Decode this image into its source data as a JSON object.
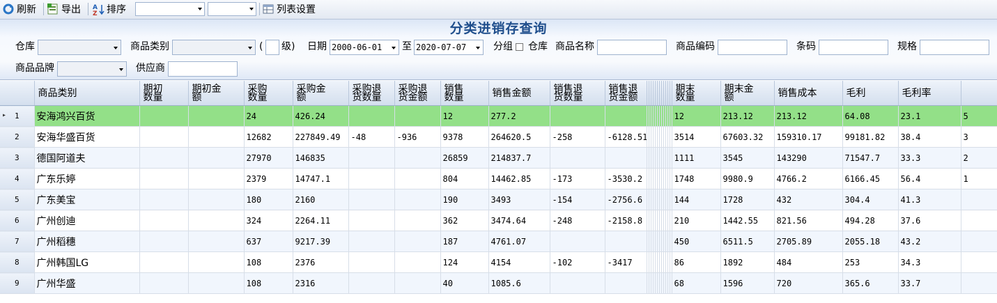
{
  "toolbar": {
    "refresh": "刷新",
    "export": "导出",
    "sort": "排序",
    "column_settings": "列表设置"
  },
  "form": {
    "title": "分类进销存查询",
    "warehouse_label": "仓库",
    "category_label": "商品类别",
    "level_open": "(",
    "level_close": "级)",
    "date_label": "日期",
    "date_from": "2000-06-01",
    "to_label": "至",
    "date_to": "2020-07-07",
    "group_label": "分组",
    "group_warehouse_label": "仓库",
    "product_name_label": "商品名称",
    "product_code_label": "商品编码",
    "barcode_label": "条码",
    "spec_label": "规格",
    "brand_label": "商品品牌",
    "supplier_label": "供应商"
  },
  "grid": {
    "columns": [
      "商品类别",
      "期初数量",
      "期初金额",
      "采购数量",
      "采购金额",
      "采购退货数量",
      "采购退货金额",
      "销售数量",
      "销售金额",
      "销售退货数量",
      "销售退货金额",
      "期末数量",
      "期末金额",
      "销售成本",
      "毛利",
      "毛利率"
    ],
    "header_lines": [
      [
        "商品类别"
      ],
      [
        "期初",
        "数量"
      ],
      [
        "期初金",
        "额"
      ],
      [
        "采购",
        "数量"
      ],
      [
        "采购金",
        "额"
      ],
      [
        "采购退",
        "货数量"
      ],
      [
        "采购退",
        "货金额"
      ],
      [
        "销售",
        "数量"
      ],
      [
        "销售金额"
      ],
      [
        "销售退",
        "货数量"
      ],
      [
        "销售退",
        "货金额"
      ],
      [
        "期末",
        "数量"
      ],
      [
        "期末金",
        "额"
      ],
      [
        "销售成本"
      ],
      [
        "毛利"
      ],
      [
        "毛利率"
      ]
    ],
    "rows": [
      {
        "n": "1",
        "cat": "安海鸿兴百货",
        "init_qty": "",
        "init_amt": "",
        "pur_qty": "24",
        "pur_amt": "426.24",
        "pret_qty": "",
        "pret_amt": "",
        "sale_qty": "12",
        "sale_amt": "277.2",
        "sret_qty": "",
        "sret_amt": "",
        "end_qty": "12",
        "end_amt": "213.12",
        "cost": "213.12",
        "profit": "64.08",
        "rate": "23.1",
        "extra": "5"
      },
      {
        "n": "2",
        "cat": "安海华盛百货",
        "init_qty": "",
        "init_amt": "",
        "pur_qty": "12682",
        "pur_amt": "227849.49",
        "pret_qty": "-48",
        "pret_amt": "-936",
        "sale_qty": "9378",
        "sale_amt": "264620.5",
        "sret_qty": "-258",
        "sret_amt": "-6128.51",
        "end_qty": "3514",
        "end_amt": "67603.32",
        "cost": "159310.17",
        "profit": "99181.82",
        "rate": "38.4",
        "extra": "3"
      },
      {
        "n": "3",
        "cat": "德国阿道夫",
        "init_qty": "",
        "init_amt": "",
        "pur_qty": "27970",
        "pur_amt": "146835",
        "pret_qty": "",
        "pret_amt": "",
        "sale_qty": "26859",
        "sale_amt": "214837.7",
        "sret_qty": "",
        "sret_amt": "",
        "end_qty": "1111",
        "end_amt": "3545",
        "cost": "143290",
        "profit": "71547.7",
        "rate": "33.3",
        "extra": "2"
      },
      {
        "n": "4",
        "cat": "广东乐婷",
        "init_qty": "",
        "init_amt": "",
        "pur_qty": "2379",
        "pur_amt": "14747.1",
        "pret_qty": "",
        "pret_amt": "",
        "sale_qty": "804",
        "sale_amt": "14462.85",
        "sret_qty": "-173",
        "sret_amt": "-3530.2",
        "end_qty": "1748",
        "end_amt": "9980.9",
        "cost": "4766.2",
        "profit": "6166.45",
        "rate": "56.4",
        "extra": "1"
      },
      {
        "n": "5",
        "cat": "广东美宝",
        "init_qty": "",
        "init_amt": "",
        "pur_qty": "180",
        "pur_amt": "2160",
        "pret_qty": "",
        "pret_amt": "",
        "sale_qty": "190",
        "sale_amt": "3493",
        "sret_qty": "-154",
        "sret_amt": "-2756.6",
        "end_qty": "144",
        "end_amt": "1728",
        "cost": "432",
        "profit": "304.4",
        "rate": "41.3",
        "extra": ""
      },
      {
        "n": "6",
        "cat": "广州创迪",
        "init_qty": "",
        "init_amt": "",
        "pur_qty": "324",
        "pur_amt": "2264.11",
        "pret_qty": "",
        "pret_amt": "",
        "sale_qty": "362",
        "sale_amt": "3474.64",
        "sret_qty": "-248",
        "sret_amt": "-2158.8",
        "end_qty": "210",
        "end_amt": "1442.55",
        "cost": "821.56",
        "profit": "494.28",
        "rate": "37.6",
        "extra": ""
      },
      {
        "n": "7",
        "cat": "广州稻穗",
        "init_qty": "",
        "init_amt": "",
        "pur_qty": "637",
        "pur_amt": "9217.39",
        "pret_qty": "",
        "pret_amt": "",
        "sale_qty": "187",
        "sale_amt": "4761.07",
        "sret_qty": "",
        "sret_amt": "",
        "end_qty": "450",
        "end_amt": "6511.5",
        "cost": "2705.89",
        "profit": "2055.18",
        "rate": "43.2",
        "extra": ""
      },
      {
        "n": "8",
        "cat": "广州韩国LG",
        "init_qty": "",
        "init_amt": "",
        "pur_qty": "108",
        "pur_amt": "2376",
        "pret_qty": "",
        "pret_amt": "",
        "sale_qty": "124",
        "sale_amt": "4154",
        "sret_qty": "-102",
        "sret_amt": "-3417",
        "end_qty": "86",
        "end_amt": "1892",
        "cost": "484",
        "profit": "253",
        "rate": "34.3",
        "extra": ""
      },
      {
        "n": "9",
        "cat": "广州华盛",
        "init_qty": "",
        "init_amt": "",
        "pur_qty": "108",
        "pur_amt": "2316",
        "pret_qty": "",
        "pret_amt": "",
        "sale_qty": "40",
        "sale_amt": "1085.6",
        "sret_qty": "",
        "sret_amt": "",
        "end_qty": "68",
        "end_amt": "1596",
        "cost": "720",
        "profit": "365.6",
        "rate": "33.7",
        "extra": ""
      }
    ]
  }
}
